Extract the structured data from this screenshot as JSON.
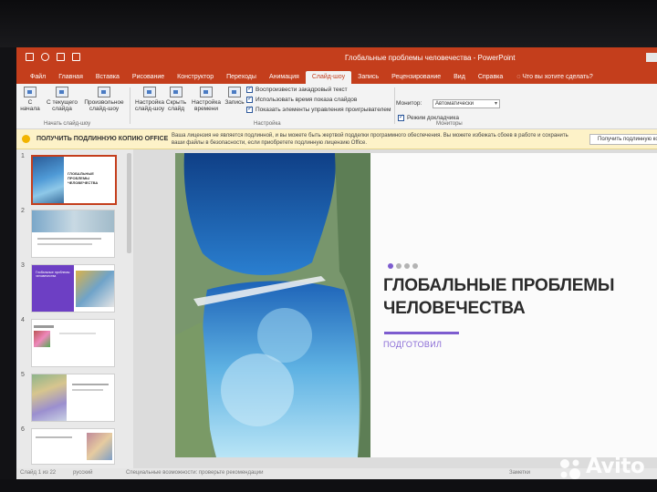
{
  "window": {
    "title": "Глобальные проблемы человечества  -  PowerPoint",
    "accent": "#c43e1c"
  },
  "ribbon_tabs": [
    "Файл",
    "Главная",
    "Вставка",
    "Рисование",
    "Конструктор",
    "Переходы",
    "Анимация",
    "Слайд-шоу",
    "Запись",
    "Рецензирование",
    "Вид",
    "Справка"
  ],
  "active_tab": "Слайд-шоу",
  "tell_me": "Что вы хотите сделать?",
  "ribbon": {
    "start_first": "С\nначала",
    "start_current": "С текущего\nслайда",
    "custom_show": "Произвольное\nслайд-шоу",
    "group_start": "Начать слайд-шоу",
    "setup": "Настройка\nслайд-шоу",
    "hide_slide": "Скрыть\nслайд",
    "rehearse": "Настройка\nвремени",
    "record": "Запись",
    "chk_narration": "Воспроизвести закадровый текст",
    "chk_timings": "Использовать время показа слайдов",
    "chk_controls": "Показать элементы управления проигрывателем",
    "group_setup": "Настройка",
    "monitor_label": "Монитор:",
    "monitor_value": "Автоматически",
    "chk_presenter": "Режим докладчика",
    "group_monitors": "Мониторы"
  },
  "license_bar": {
    "title": "ПОЛУЧИТЬ ПОДЛИННУЮ КОПИЮ OFFICE",
    "message": "Ваша лицензия не является подлинной, и вы можете быть жертвой подделки программного обеспечения. Вы можете избежать сбоев в работе и сохранить ваши файлы в безопасности, если приобретете подлинную лицензию Office.",
    "button": "Получить подлинную копию"
  },
  "thumbnails": [
    {
      "num": "1",
      "text": "ГЛОБАЛЬНЫЕ ПРОБЛЕМЫ ЧЕЛОВЕЧЕСТВА"
    },
    {
      "num": "2",
      "text": ""
    },
    {
      "num": "3",
      "text": "Глобальные проблемы человечества"
    },
    {
      "num": "4",
      "text": ""
    },
    {
      "num": "5",
      "text": ""
    },
    {
      "num": "6",
      "text": ""
    }
  ],
  "slide": {
    "title": "ГЛОБАЛЬНЫЕ ПРОБЛЕМЫ ЧЕЛОВЕЧЕСТВА",
    "subtitle": "ПОДГОТОВИЛ",
    "accent": "#7d5ccf"
  },
  "status_bar": {
    "slide_info": "Слайд 1 из 22",
    "language": "русский",
    "accessibility": "Специальные возможности: проверьте рекомендации",
    "notes": "Заметки"
  },
  "watermark": "Avito"
}
